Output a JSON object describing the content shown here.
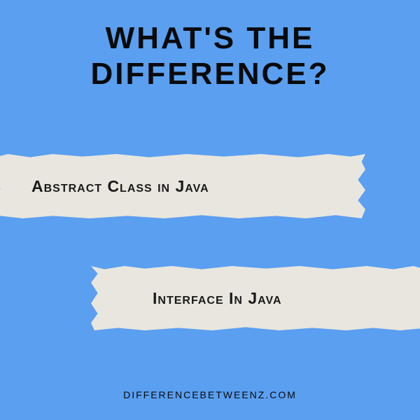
{
  "title_line1": "WHAT'S THE",
  "title_line2": "DIFFERENCE?",
  "tape1_text": "Abstract Class in Java",
  "tape2_text": "Interface In Java",
  "footer_text": "DIFFERENCEBETWEENZ.COM",
  "colors": {
    "background": "#5a9ff0",
    "tape": "#e8e6de",
    "text": "#0a0a0a"
  }
}
